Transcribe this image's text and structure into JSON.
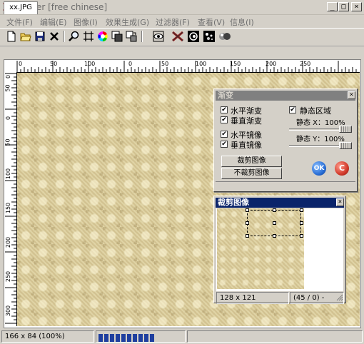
{
  "window": {
    "title": "XFader [free chinese]",
    "buttons": {
      "minimize": "_",
      "maximize": "□",
      "close": "×"
    }
  },
  "menu": [
    "文件(F)",
    "编辑(E)",
    "图像(I)",
    "效果生成(G)",
    "过滤器(F)",
    "查看(V)",
    "信息(I)"
  ],
  "toolbar": {
    "icons": [
      "new-file-icon",
      "open-folder-icon",
      "save-icon",
      "close-icon",
      "zoom-icon",
      "crosshair-icon",
      "color-wheel-icon",
      "layers-icon",
      "transform-icon",
      "eye-icon",
      "xfader-icon",
      "spiral-icon",
      "noise-icon",
      "sphere-icon"
    ]
  },
  "tab": {
    "label": "xx.JPG"
  },
  "ruler": {
    "top_labels": [
      "0",
      "50",
      "100",
      "0",
      "50",
      "100",
      "150",
      "200",
      "250"
    ],
    "left_labels": [
      "0",
      "50",
      "0",
      "50",
      "100",
      "150",
      "200",
      "250",
      "300"
    ]
  },
  "gradient_dialog": {
    "title": "渐变",
    "close": "×",
    "options": [
      {
        "label": "水平渐变",
        "checked": true
      },
      {
        "label": "垂直渐变",
        "checked": true
      },
      {
        "label": "水平镜像",
        "checked": true
      },
      {
        "label": "垂直镜像",
        "checked": true
      }
    ],
    "static_region": {
      "label": "静态区域",
      "checked": true
    },
    "static_x": {
      "label": "静态 X：100%",
      "value_pct": 100
    },
    "static_y": {
      "label": "静态 Y：100%",
      "value_pct": 100
    },
    "crop_button": "裁剪图像",
    "nocrop_button": "不裁剪图像",
    "ok_button": "OK",
    "cancel_button": "C"
  },
  "crop_dialog": {
    "title": "裁剪图像",
    "close": "×",
    "size_text": "128 x 121",
    "offset_text": "(45 / 0) -"
  },
  "status": {
    "size_text": "166 x 84  (100%)",
    "progress_segments": 10
  },
  "colors": {
    "canvas": "#d9ca98",
    "title_active": "#0a246a",
    "ok_blue": "#2a6fd6",
    "cancel_red": "#d23a2a"
  }
}
